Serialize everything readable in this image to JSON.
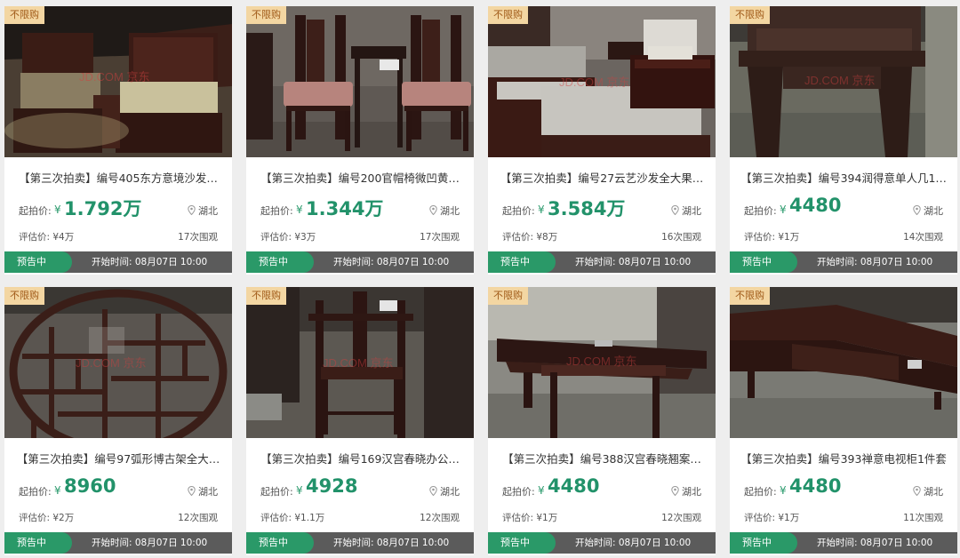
{
  "listings": [
    {
      "badge": "不限购",
      "title": "【第三次拍卖】编号405东方意境沙发…",
      "price_label": "起拍价:",
      "currency": "¥",
      "price": "1.792万",
      "location": "湖北",
      "estimate": "评估价: ¥4万",
      "views": "17次围观",
      "status": "预告中",
      "start_time": "开始时间: 08月07日 10:00",
      "image": "sofa-set",
      "watermark": "JD.COM 京东"
    },
    {
      "badge": "不限购",
      "title": "【第三次拍卖】编号200官帽椅微凹黄…",
      "price_label": "起拍价:",
      "currency": "¥",
      "price": "1.344万",
      "location": "湖北",
      "estimate": "评估价: ¥3万",
      "views": "17次围观",
      "status": "预告中",
      "start_time": "开始时间: 08月07日 10:00",
      "image": "armchairs-with-table",
      "watermark": ""
    },
    {
      "badge": "不限购",
      "title": "【第三次拍卖】编号27云艺沙发全大果…",
      "price_label": "起拍价:",
      "currency": "¥",
      "price": "3.584万",
      "location": "湖北",
      "estimate": "评估价: ¥8万",
      "views": "16次围观",
      "status": "预告中",
      "start_time": "开始时间: 08月07日 10:00",
      "image": "cushioned-sofa-set",
      "watermark": "JD.COM 京东"
    },
    {
      "badge": "不限购",
      "title": "【第三次拍卖】编号394润得意单人几1…",
      "price_label": "起拍价:",
      "currency": "¥",
      "price": "4480",
      "location": "湖北",
      "estimate": "评估价: ¥1万",
      "views": "14次围观",
      "status": "预告中",
      "start_time": "开始时间: 08月07日 10:00",
      "image": "side-table",
      "watermark": "JD.COM 京东"
    },
    {
      "badge": "不限购",
      "title": "【第三次拍卖】编号97弧形博古架全大…",
      "price_label": "起拍价:",
      "currency": "¥",
      "price": "8960",
      "location": "湖北",
      "estimate": "评估价: ¥2万",
      "views": "12次围观",
      "status": "预告中",
      "start_time": "开始时间: 08月07日 10:00",
      "image": "round-display-shelf",
      "watermark": "JD.COM 京东"
    },
    {
      "badge": "不限购",
      "title": "【第三次拍卖】编号169汉宫春晓办公…",
      "price_label": "起拍价:",
      "currency": "¥",
      "price": "4928",
      "location": "湖北",
      "estimate": "评估价: ¥1.1万",
      "views": "12次围观",
      "status": "预告中",
      "start_time": "开始时间: 08月07日 10:00",
      "image": "office-chair",
      "watermark": "JD.COM 京东"
    },
    {
      "badge": "不限购",
      "title": "【第三次拍卖】编号388汉宫春晓翘案…",
      "price_label": "起拍价:",
      "currency": "¥",
      "price": "4480",
      "location": "湖北",
      "estimate": "评估价: ¥1万",
      "views": "12次围观",
      "status": "预告中",
      "start_time": "开始时间: 08月07日 10:00",
      "image": "altar-table",
      "watermark": "JD.COM 京东"
    },
    {
      "badge": "不限购",
      "title": "【第三次拍卖】编号393禅意电视柜1件套",
      "price_label": "起拍价:",
      "currency": "¥",
      "price": "4480",
      "location": "湖北",
      "estimate": "评估价: ¥1万",
      "views": "11次围观",
      "status": "预告中",
      "start_time": "开始时间: 08月07日 10:00",
      "image": "tv-cabinet",
      "watermark": ""
    }
  ],
  "colors": {
    "price_green": "#22926a",
    "status_green": "#2a9968",
    "footer_gray": "#5b5b5b",
    "badge_bg": "#f3d6a2",
    "badge_text": "#a05a18",
    "wood": "#3a1e18"
  },
  "icons": {
    "location": "map-pin-icon"
  }
}
